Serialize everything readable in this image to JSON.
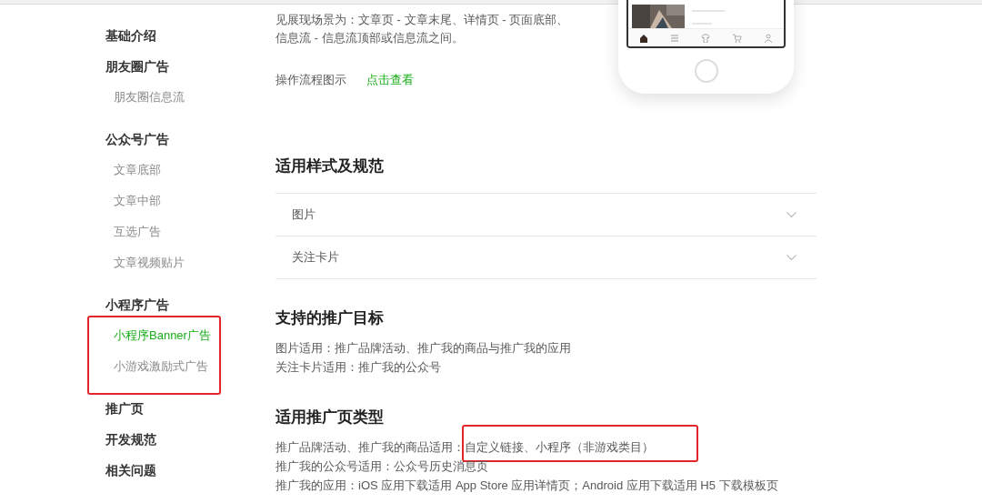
{
  "sidebar": [
    {
      "label": "基础介绍",
      "highlighted": false
    },
    {
      "label": "朋友圈广告",
      "highlighted": false,
      "children": [
        {
          "label": "朋友圈信息流",
          "selected": false
        }
      ]
    },
    {
      "label": "公众号广告",
      "highlighted": false,
      "children": [
        {
          "label": "文章底部",
          "selected": false
        },
        {
          "label": "文章中部",
          "selected": false
        },
        {
          "label": "互选广告",
          "selected": false
        },
        {
          "label": "文章视频贴片",
          "selected": false
        }
      ]
    },
    {
      "label": "小程序广告",
      "highlighted": true,
      "children": [
        {
          "label": "小程序Banner广告",
          "selected": true
        },
        {
          "label": "小游戏激励式广告",
          "selected": false
        }
      ]
    },
    {
      "label": "推广页",
      "highlighted": false
    },
    {
      "label": "开发规范",
      "highlighted": false
    },
    {
      "label": "相关问题",
      "highlighted": false
    }
  ],
  "intro": {
    "lines": [
      "见展现场景为：文章页 - 文章末尾、详情页 - 页面底部、",
      "信息流 - 信息流顶部或信息流之间。"
    ],
    "flow_label": "操作流程图示",
    "flow_link": "点击查看"
  },
  "phone_preview": {
    "tabs": [
      {
        "kind": "home",
        "selected": true
      },
      {
        "kind": "list",
        "selected": false
      },
      {
        "kind": "shirt",
        "selected": false
      },
      {
        "kind": "cart",
        "selected": false
      },
      {
        "kind": "person",
        "selected": false
      }
    ]
  },
  "sections": [
    {
      "title": "适用样式及规范",
      "accordion": [
        {
          "label": "图片",
          "expanded": false
        },
        {
          "label": "关注卡片",
          "expanded": false
        }
      ]
    },
    {
      "title": "支持的推广目标",
      "lines": [
        {
          "text": "图片适用：推广品牌活动、推广我的商品与推广我的应用"
        },
        {
          "text": "关注卡片适用：推广我的公众号"
        }
      ]
    },
    {
      "title": "适用推广页类型",
      "lines": [
        {
          "text": "推广品牌活动、推广我的商品适用：",
          "highlight": "自定义链接、小程序（非游戏类目）"
        },
        {
          "text": "推广我的公众号适用：公众号历史消息页"
        },
        {
          "text": "推广我的应用：iOS 应用下载适用 App Store 应用详情页；Android 应用下载适用 H5 下载模板页"
        }
      ]
    }
  ]
}
